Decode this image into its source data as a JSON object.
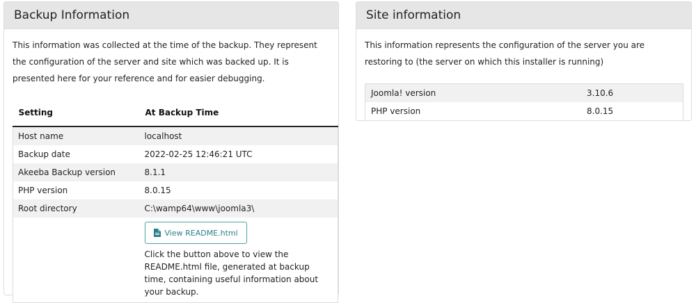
{
  "backup_panel": {
    "title": "Backup Information",
    "intro": "This information was collected at the time of the backup. They represent the configuration of the server and site which was backed up. It is presented here for your reference and for easier debugging.",
    "columns": [
      "Setting",
      "At Backup Time"
    ],
    "rows": [
      {
        "setting": "Host name",
        "value": "localhost"
      },
      {
        "setting": "Backup date",
        "value": "2022-02-25 12:46:21 UTC"
      },
      {
        "setting": "Akeeba Backup version",
        "value": "8.1.1"
      },
      {
        "setting": "PHP version",
        "value": "8.0.15"
      },
      {
        "setting": "Root directory",
        "value": "C:\\wamp64\\www\\joomla3\\"
      }
    ],
    "readme_button": "View README.html",
    "readme_note": "Click the button above to view the README.html file, generated at backup time, containing useful information about your backup."
  },
  "site_panel": {
    "title": "Site information",
    "intro": "This information represents the configuration of the server you are restoring to (the server on which this installer is running)",
    "rows": [
      {
        "setting": "Joomla! version",
        "value": "3.10.6"
      },
      {
        "setting": "PHP version",
        "value": "8.0.15"
      }
    ]
  },
  "colors": {
    "header_bg": "#e6e6e6",
    "stripe": "#f1f1f1",
    "button_accent": "#2c7f8a"
  }
}
